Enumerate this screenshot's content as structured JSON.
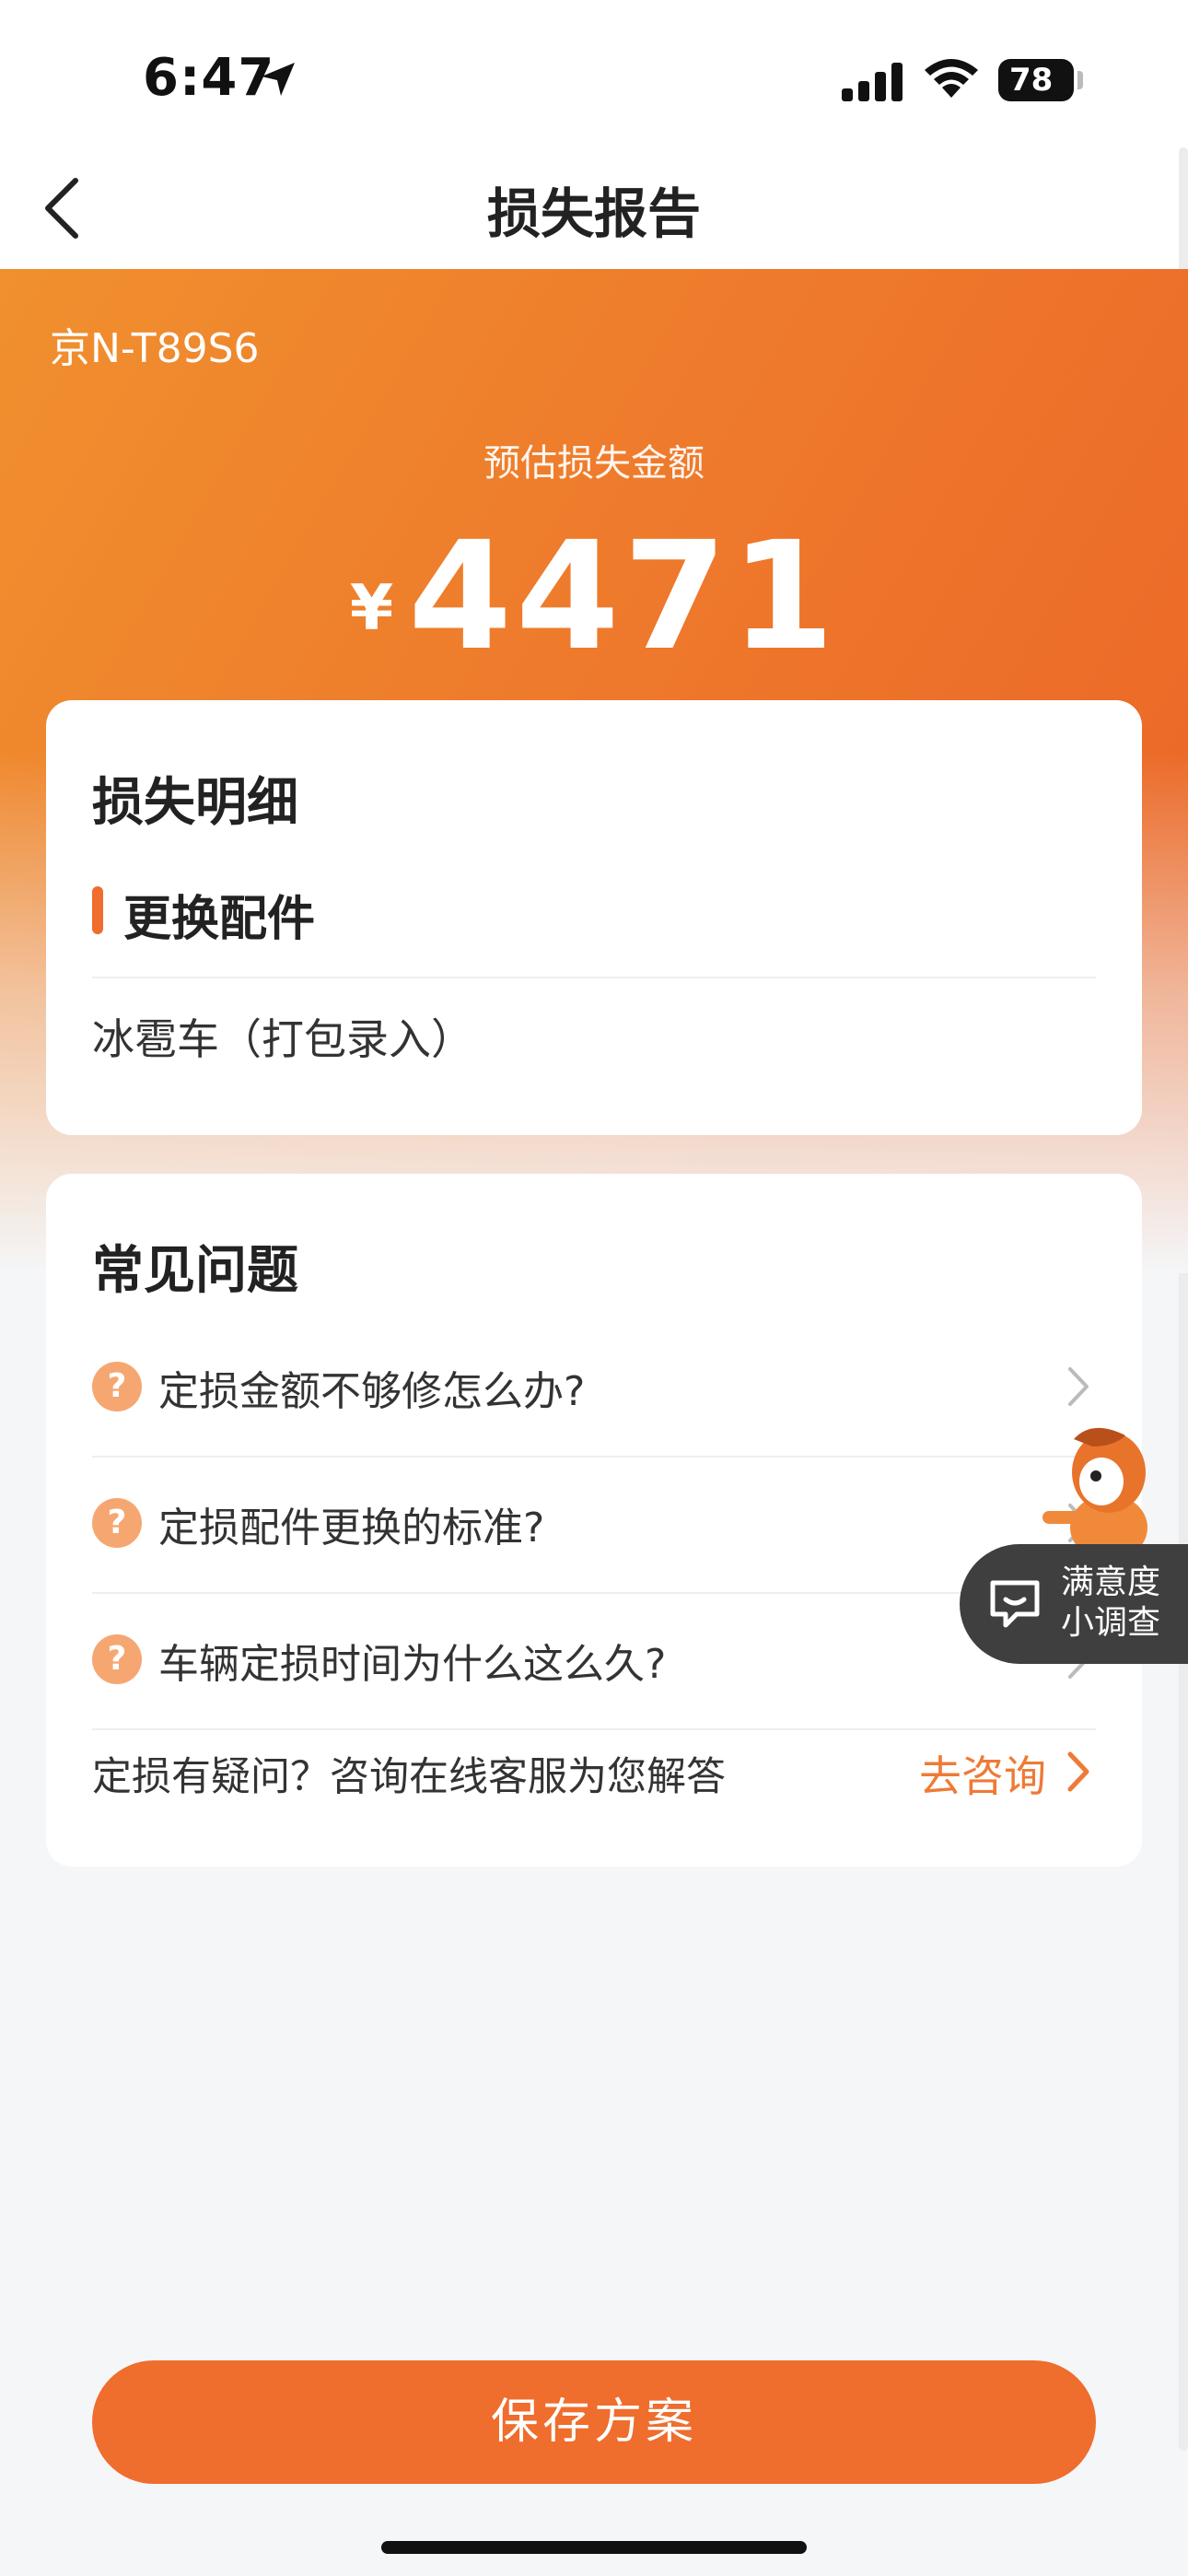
{
  "status_bar": {
    "time": "6:47",
    "battery": "78"
  },
  "nav": {
    "title": "损失报告"
  },
  "hero": {
    "plate": "京N-T89S6",
    "estimate_label": "预估损失金额",
    "currency": "¥",
    "amount": "4471"
  },
  "detail_card": {
    "title": "损失明细",
    "section_title": "更换配件",
    "item": "冰雹车（打包录入）"
  },
  "faq_card": {
    "title": "常见问题",
    "question_mark": "?",
    "questions": [
      "定损金额不够修怎么办?",
      "定损配件更换的标准?",
      "车辆定损时间为什么这么久?"
    ],
    "consult_text": "定损有疑问？咨询在线客服为您解答",
    "consult_link": "去咨询"
  },
  "survey": {
    "line1": "满意度",
    "line2": "小调查"
  },
  "bottom": {
    "save_label": "保存方案"
  },
  "colors": {
    "accent": "#ef6d2d",
    "question_icon": "#f6a771"
  },
  "icons": [
    "location-arrow-icon",
    "cellular-signal-icon",
    "wifi-icon",
    "battery-icon",
    "back-chevron-icon",
    "question-icon",
    "chevron-right-icon",
    "survey-chat-icon",
    "mascot-icon"
  ]
}
